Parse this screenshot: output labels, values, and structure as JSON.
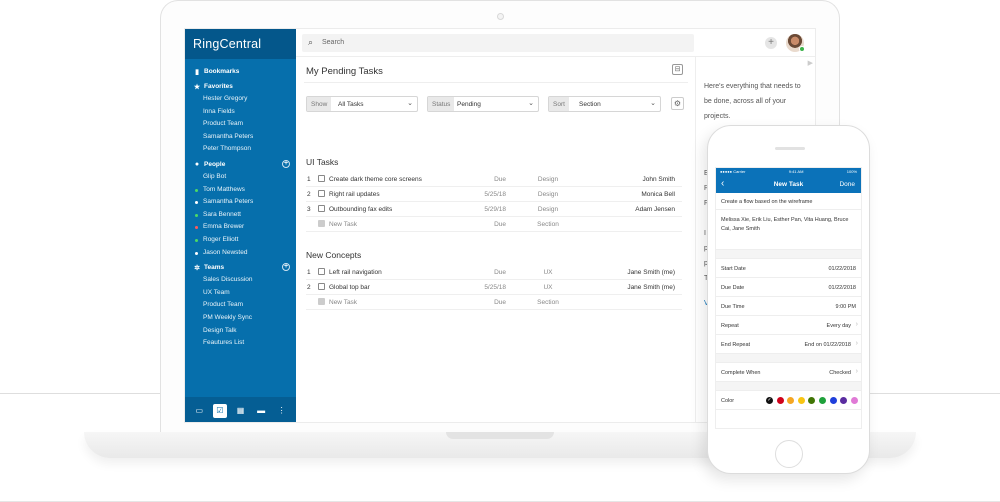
{
  "app": {
    "brand": "RingCentral",
    "search_placeholder": "Search",
    "add_symbol": "+"
  },
  "sidebar": {
    "sections": [
      {
        "key": "bookmarks",
        "title": "Bookmarks",
        "icon": "bookmark-icon",
        "items": []
      },
      {
        "key": "favorites",
        "title": "Favorites",
        "icon": "star-icon",
        "items": [
          {
            "label": "Hester Gregory"
          },
          {
            "label": "Inna Fields"
          },
          {
            "label": "Product Team"
          },
          {
            "label": "Samantha Peters"
          },
          {
            "label": "Peter Thompson"
          }
        ]
      },
      {
        "key": "people",
        "title": "People",
        "icon": "person-icon",
        "items": [
          {
            "label": "Glip Bot",
            "status": ""
          },
          {
            "label": "Tom Matthews",
            "status": "#4cd964"
          },
          {
            "label": "Samantha Peters",
            "status": "#ffffff"
          },
          {
            "label": "Sara Bennett",
            "status": "#4cd964"
          },
          {
            "label": "Emma Brewer",
            "status": "#ff5a5a"
          },
          {
            "label": "Roger Elliott",
            "status": "#4cd964"
          },
          {
            "label": "Jason Newsted",
            "status": "#ffffff"
          }
        ]
      },
      {
        "key": "teams",
        "title": "Teams",
        "icon": "team-icon",
        "items": [
          {
            "label": "Sales Discussion"
          },
          {
            "label": "UX Team"
          },
          {
            "label": "Product Team"
          },
          {
            "label": "PM Weekly Sync"
          },
          {
            "label": "Design Talk"
          },
          {
            "label": "Feautures List"
          }
        ]
      }
    ],
    "bottom_icons": [
      "inbox-icon",
      "tasks-icon",
      "calendar-icon",
      "files-icon",
      "more-icon"
    ]
  },
  "main": {
    "title": "My Pending Tasks",
    "filters": [
      {
        "label": "Show",
        "value": "All Tasks"
      },
      {
        "label": "Status",
        "value": "Pending"
      },
      {
        "label": "Sort",
        "value": "Section"
      }
    ],
    "groups": [
      {
        "title": "UI Tasks",
        "rows": [
          {
            "num": "1",
            "name": "Create dark theme core screens",
            "due": "Due",
            "section": "Design",
            "assignee": "John Smith"
          },
          {
            "num": "2",
            "name": "Right rail updates",
            "due": "5/25/18",
            "section": "Design",
            "assignee": "Monica Bell"
          },
          {
            "num": "3",
            "name": "Outbounding fax edits",
            "due": "5/29/18",
            "section": "Design",
            "assignee": "Adam Jensen"
          }
        ],
        "new_row": {
          "name": "New Task",
          "due": "Due",
          "section": "Section"
        }
      },
      {
        "title": "New Concepts",
        "rows": [
          {
            "num": "1",
            "name": "Left rail navigation",
            "due": "Due",
            "section": "UX",
            "assignee": "Jane Smith (me)"
          },
          {
            "num": "2",
            "name": "Global top bar",
            "due": "5/25/18",
            "section": "UX",
            "assignee": "Jane Smith (me)"
          }
        ],
        "new_row": {
          "name": "New Task",
          "due": "Due",
          "section": "Section"
        }
      }
    ]
  },
  "right_panel": {
    "description": "Here's everything that needs to be done, across all of your projects.",
    "partial_letters": [
      "E",
      "P",
      "F",
      "I",
      "p",
      "p",
      "T",
      "V"
    ]
  },
  "phone": {
    "status_left": "●●●●● Carrier",
    "status_time": "9:41 AM",
    "status_right": "100%",
    "nav_title": "New Task",
    "nav_done": "Done",
    "description": "Create a flow based on the wireframe",
    "assignees": "Melissa Xie, Erik Liu, Esther Pan, Vita Huang, Bruce Cai, Jane Smith",
    "fields": [
      {
        "label": "Start Date",
        "value": "01/22/2018",
        "chevron": false
      },
      {
        "label": "Due Date",
        "value": "01/22/2018",
        "chevron": false
      },
      {
        "label": "Due Time",
        "value": "9:00 PM",
        "chevron": false
      },
      {
        "label": "Repeat",
        "value": "Every day",
        "chevron": true
      },
      {
        "label": "End Repeat",
        "value": "End on 01/22/2018",
        "chevron": true
      }
    ],
    "complete_when": {
      "label": "Complete When",
      "value": "Checked"
    },
    "color_label": "Color",
    "colors": [
      "#111111",
      "#d0021b",
      "#f5a623",
      "#f8c513",
      "#417505",
      "#1fa13b",
      "#1f3fdb",
      "#5a2ca0",
      "#e07ad6"
    ]
  }
}
